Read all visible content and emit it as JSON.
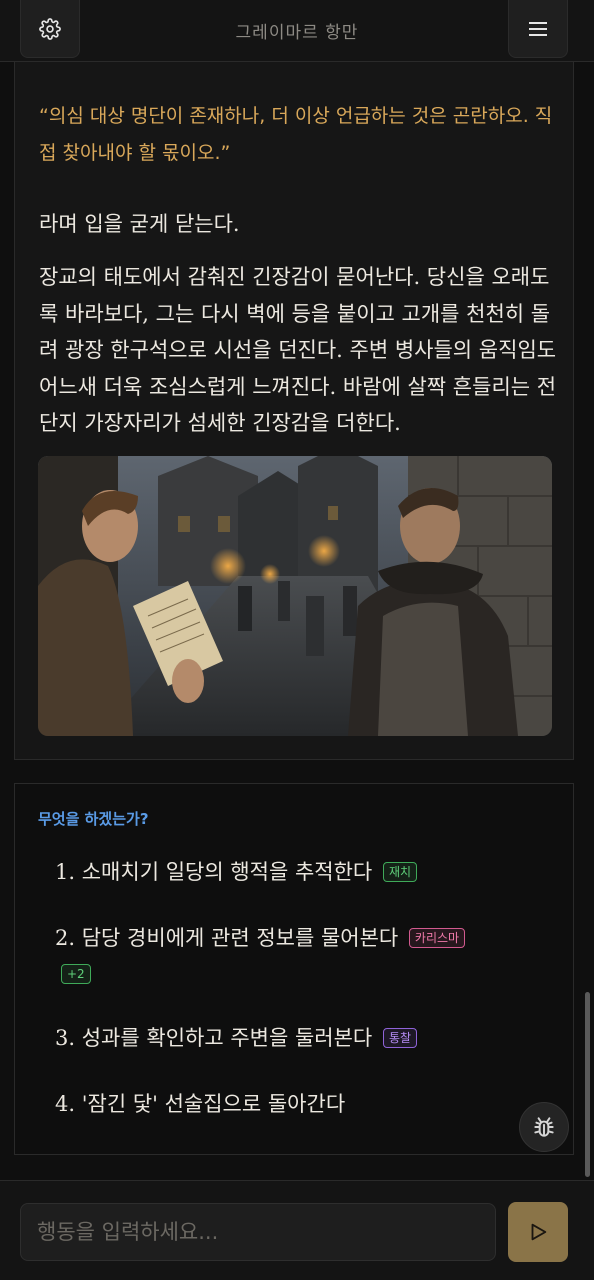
{
  "header": {
    "title": "그레이마르 항만",
    "settings_icon": "gear-icon",
    "menu_icon": "hamburger-menu-icon"
  },
  "story": {
    "quote": "“의심 대상 명단이 존재하나, 더 이상 언급하는 것은 곤란하오. 직접 찾아내야 할 몫이오.”",
    "para1": "라며 입을 굳게 닫는다.",
    "para2": "장교의 태도에서 감춰진 긴장감이 묻어난다. 당신을 오래도록 바라보다, 그는 다시 벽에 등을 붙이고 고개를 천천히 돌려 광장 한구석으로 시선을 던진다. 주변 병사들의 움직임도 어느새 더욱 조심스럽게 느껴진다. 바람에 살짝 흔들리는 전단지 가장자리가 섬세한 긴장감을 더한다."
  },
  "choices": {
    "prompt": "무엇을 하겠는가?",
    "items": [
      {
        "number": "1.",
        "text": "소매치기 일당의 행적을 추적한다",
        "tags": [
          "재치"
        ]
      },
      {
        "number": "2.",
        "text": "담당 경비에게 관련 정보를 물어본다",
        "tags": [
          "카리스마",
          "+2"
        ]
      },
      {
        "number": "3.",
        "text": "성과를 확인하고 주변을 둘러본다",
        "tags": [
          "통찰"
        ]
      },
      {
        "number": "4.",
        "text": "'잠긴 닻' 선술집으로 돌아간다",
        "tags": []
      }
    ]
  },
  "input": {
    "placeholder": "행동을 입력하세요...",
    "value": ""
  },
  "colors": {
    "quote": "#d9a85a",
    "prompt": "#5a9be6",
    "tag_green": "#5fd07a",
    "tag_pink": "#f07aaa",
    "tag_purple": "#b48cf2",
    "send_button": "#8a7448"
  },
  "icons": {
    "debug": "bug-icon",
    "send": "play-send-icon"
  }
}
